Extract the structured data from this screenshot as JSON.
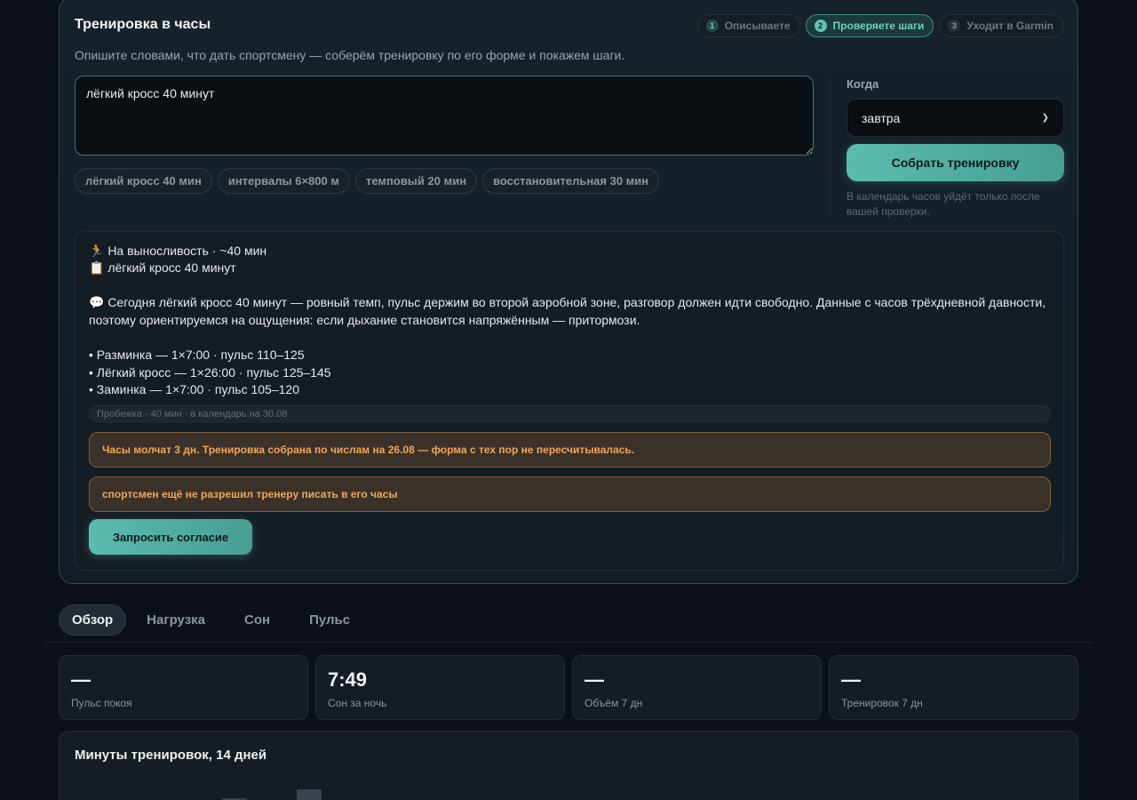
{
  "composer": {
    "title": "Тренировка в часы",
    "subtitle": "Опишите словами, что дать спортсмену — соберём тренировку по его форме и покажем шаги.",
    "steps": [
      {
        "num": "1",
        "label": "Описываете"
      },
      {
        "num": "2",
        "label": "Проверяете шаги"
      },
      {
        "num": "3",
        "label": "Уходит в Garmin"
      }
    ],
    "textarea_value": "лёгкий кросс 40 минут",
    "chips": [
      "лёгкий кросс 40 мин",
      "интервалы 6×800 м",
      "темповый 20 мин",
      "восстановительная 30 мин"
    ],
    "when_label": "Когда",
    "when_value": "завтра",
    "build_button": "Собрать тренировку",
    "note": "В календарь часов уйдёт только после вашей проверки."
  },
  "result": {
    "line1": "🏃 На выносливость · ~40 мин",
    "line2": "📋 лёгкий кросс 40 минут",
    "comment": "💬 Сегодня лёгкий кросс 40 минут — ровный темп, пульс держим во второй аэробной зоне, разговор должен идти свободно. Данные с часов трёхдневной давности, поэтому ориентируемся на ощущения: если дыхание становится напряжённым — притормози.",
    "steps": [
      "• Разминка — 1×7:00 · пульс 110–125",
      "• Лёгкий кросс — 1×26:00 · пульс 125–145",
      "• Заминка — 1×7:00 · пульс 105–120"
    ],
    "meta": "Пробежка · 40 мин · в календарь на 30.08",
    "warning1": "Часы молчат 3 дн. Тренировка собрана по числам на 26.08 — форма с тех пор не пересчитывалась.",
    "warning2": "спортсмен ещё не разрешил тренеру писать в его часы",
    "consent_button": "Запросить согласие"
  },
  "tabs": [
    "Обзор",
    "Нагрузка",
    "Сон",
    "Пульс"
  ],
  "stats": [
    {
      "value": "—",
      "label": "Пульс покоя"
    },
    {
      "value": "7:49",
      "label": "Сон за ночь"
    },
    {
      "value": "—",
      "label": "Объём 7 дн"
    },
    {
      "value": "—",
      "label": "Тренировок 7 дн"
    }
  ],
  "chart": {
    "title": "Минуты тренировок, 14 дней"
  },
  "colors": {
    "accent": "#5bbcae",
    "warning": "#f0a658",
    "background": "#0c1117"
  }
}
